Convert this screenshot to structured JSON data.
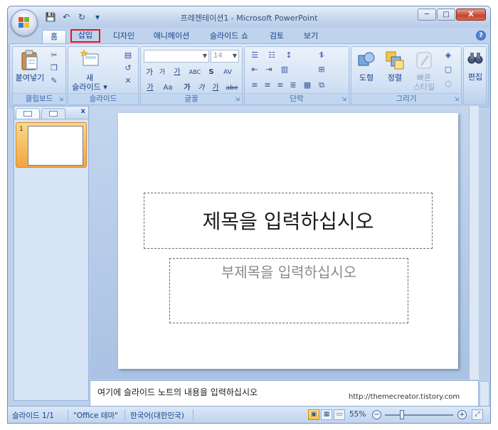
{
  "window": {
    "title": "프레젠테이션1 - Microsoft PowerPoint",
    "controls": {
      "minimize": "─",
      "maximize": "□",
      "close": "X"
    }
  },
  "qat": {
    "save": "💾",
    "undo": "↶",
    "redo": "↻",
    "customize": "▾"
  },
  "tabs": [
    {
      "label": "홈"
    },
    {
      "label": "삽입"
    },
    {
      "label": "디자인"
    },
    {
      "label": "애니메이션"
    },
    {
      "label": "슬라이드 쇼"
    },
    {
      "label": "검토"
    },
    {
      "label": "보기"
    }
  ],
  "help": "?",
  "ribbon": {
    "clipboard": {
      "label": "클립보드",
      "paste": "붙여넣기"
    },
    "slides": {
      "label": "슬라이드",
      "new_slide_line1": "새",
      "new_slide_line2": "슬라이드 ▾"
    },
    "font": {
      "label": "글꼴",
      "font_name": "",
      "font_size": "14",
      "grow": "가",
      "shrink": "가",
      "clear": "가",
      "abc": "ABC",
      "spacing": "AV",
      "bold": "가",
      "italic": "가",
      "underline": "가",
      "strike": "abe",
      "shadow": "S",
      "change_case": "가",
      "aa": "Aa",
      "color": "가"
    },
    "paragraph": {
      "label": "단락"
    },
    "drawing": {
      "label": "그리기",
      "shapes": "도형",
      "arrange": "정렬",
      "quick_styles_line1": "빠른",
      "quick_styles_line2": "스타일"
    },
    "editing": {
      "label": "편집"
    }
  },
  "left_pane": {
    "close": "x",
    "slide_number": "1"
  },
  "slide": {
    "title_placeholder": "제목을 입력하십시오",
    "subtitle_placeholder": "부제목을 입력하십시오"
  },
  "notes": {
    "placeholder": "여기에 슬라이드 노트의 내용을 입력하십시오"
  },
  "status": {
    "slide": "슬라이드 1/1",
    "theme": "\"Office 테마\"",
    "language": "한국어(대한민국)",
    "zoom": "55%",
    "zoom_value": 55
  },
  "watermark": "http://themecreator.tistory.com",
  "colors": {
    "highlight_border": "#e8141c",
    "accent": "#15428b"
  }
}
